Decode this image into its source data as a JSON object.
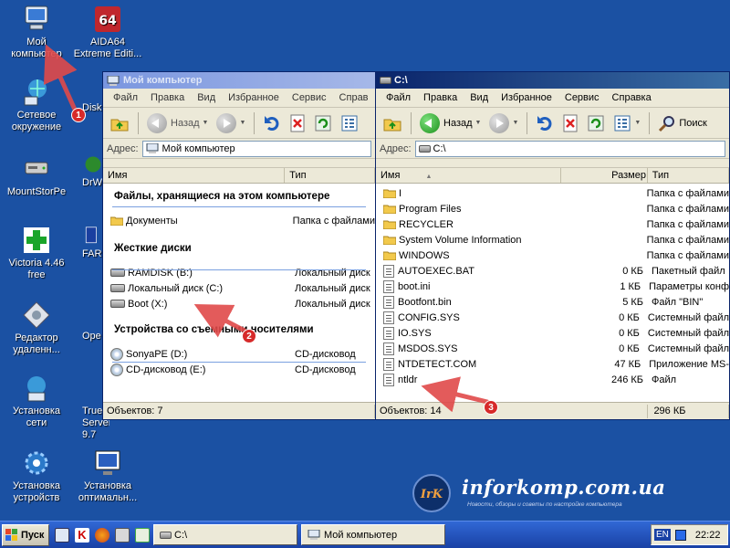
{
  "desktop": {
    "icons": [
      {
        "label": "Мой компьютер",
        "icon": "my-computer-icon"
      },
      {
        "label": "AIDA64 Extreme Editi...",
        "icon": "aida64-icon"
      },
      {
        "label": "Сетевое окружение",
        "icon": "network-icon"
      },
      {
        "label": "Disk",
        "icon": "disk-icon"
      },
      {
        "label": "MountStorPe",
        "icon": "mountstorpe-icon"
      },
      {
        "label": "DrW",
        "icon": "drw-icon"
      },
      {
        "label": "Victoria 4.46 free",
        "icon": "victoria-icon"
      },
      {
        "label": "FAR",
        "icon": "far-icon"
      },
      {
        "label": "Редактор удаленн...",
        "icon": "remote-editor-icon"
      },
      {
        "label": "Ope",
        "icon": "ope-icon"
      },
      {
        "label": "Установка сети",
        "icon": "network-setup-icon"
      },
      {
        "label": "True Server 9.7",
        "icon": "trueserver-icon"
      },
      {
        "label": "Установка устройств",
        "icon": "device-setup-icon"
      },
      {
        "label": "Установка оптимальн...",
        "icon": "optimal-setup-icon"
      }
    ]
  },
  "window_mycomputer": {
    "title": "Мой компьютер",
    "menu": [
      "Файл",
      "Правка",
      "Вид",
      "Избранное",
      "Сервис",
      "Справ"
    ],
    "toolbar": {
      "back_label": "Назад"
    },
    "address_label": "Адрес:",
    "address_value": "Мой компьютер",
    "columns": [
      "Имя",
      "Тип"
    ],
    "groups": [
      {
        "title": "Файлы, хранящиеся на этом компьютере",
        "items": [
          {
            "name": "Документы",
            "type": "Папка с файлами"
          }
        ]
      },
      {
        "title": "Жесткие диски",
        "items": [
          {
            "name": "RAMDISK (B:)",
            "type": "Локальный диск"
          },
          {
            "name": "Локальный диск (C:)",
            "type": "Локальный диск"
          },
          {
            "name": "Boot (X:)",
            "type": "Локальный диск"
          }
        ]
      },
      {
        "title": "Устройства со съемными носителями",
        "items": [
          {
            "name": "SonyaPE (D:)",
            "type": "CD-дисковод"
          },
          {
            "name": "CD-дисковод (E:)",
            "type": "CD-дисковод"
          }
        ]
      }
    ],
    "status": "Объектов: 7"
  },
  "window_c": {
    "title": "C:\\",
    "menu": [
      "Файл",
      "Правка",
      "Вид",
      "Избранное",
      "Сервис",
      "Справка"
    ],
    "toolbar": {
      "back_label": "Назад",
      "search_label": "Поиск"
    },
    "address_label": "Адрес:",
    "address_value": "C:\\",
    "columns": [
      "Имя",
      "Размер",
      "Тип"
    ],
    "files": [
      {
        "name": "I",
        "size": "",
        "type": "Папка с файлами",
        "kind": "folder"
      },
      {
        "name": "Program Files",
        "size": "",
        "type": "Папка с файлами",
        "kind": "folder"
      },
      {
        "name": "RECYCLER",
        "size": "",
        "type": "Папка с файлами",
        "kind": "folder"
      },
      {
        "name": "System Volume Information",
        "size": "",
        "type": "Папка с файлами",
        "kind": "folder"
      },
      {
        "name": "WINDOWS",
        "size": "",
        "type": "Папка с файлами",
        "kind": "folder"
      },
      {
        "name": "AUTOEXEC.BAT",
        "size": "0 КБ",
        "type": "Пакетный файл",
        "kind": "file"
      },
      {
        "name": "boot.ini",
        "size": "1 КБ",
        "type": "Параметры конф",
        "kind": "file"
      },
      {
        "name": "Bootfont.bin",
        "size": "5 КБ",
        "type": "Файл \"BIN\"",
        "kind": "file"
      },
      {
        "name": "CONFIG.SYS",
        "size": "0 КБ",
        "type": "Системный файл",
        "kind": "file"
      },
      {
        "name": "IO.SYS",
        "size": "0 КБ",
        "type": "Системный файл",
        "kind": "file"
      },
      {
        "name": "MSDOS.SYS",
        "size": "0 КБ",
        "type": "Системный файл",
        "kind": "file"
      },
      {
        "name": "NTDETECT.COM",
        "size": "47 КБ",
        "type": "Приложение MS-",
        "kind": "file"
      },
      {
        "name": "ntldr",
        "size": "246 КБ",
        "type": "Файл",
        "kind": "file"
      }
    ],
    "status": "Объектов: 14",
    "status_size": "296 КБ"
  },
  "taskbar": {
    "start_label": "Пуск",
    "tasks": [
      "C:\\",
      "Мой компьютер"
    ],
    "lang": "EN",
    "clock": "22:22"
  },
  "annotations": [
    "1",
    "2",
    "3"
  ],
  "watermark": {
    "site": "inforkomp.com.ua",
    "logo": "IrK",
    "tagline": "Новости, обзоры и советы по настройке компьютера"
  },
  "colors": {
    "desktop": "#1b51a3",
    "annotation": "#d62a2a",
    "arrow": "#e04a4a"
  }
}
